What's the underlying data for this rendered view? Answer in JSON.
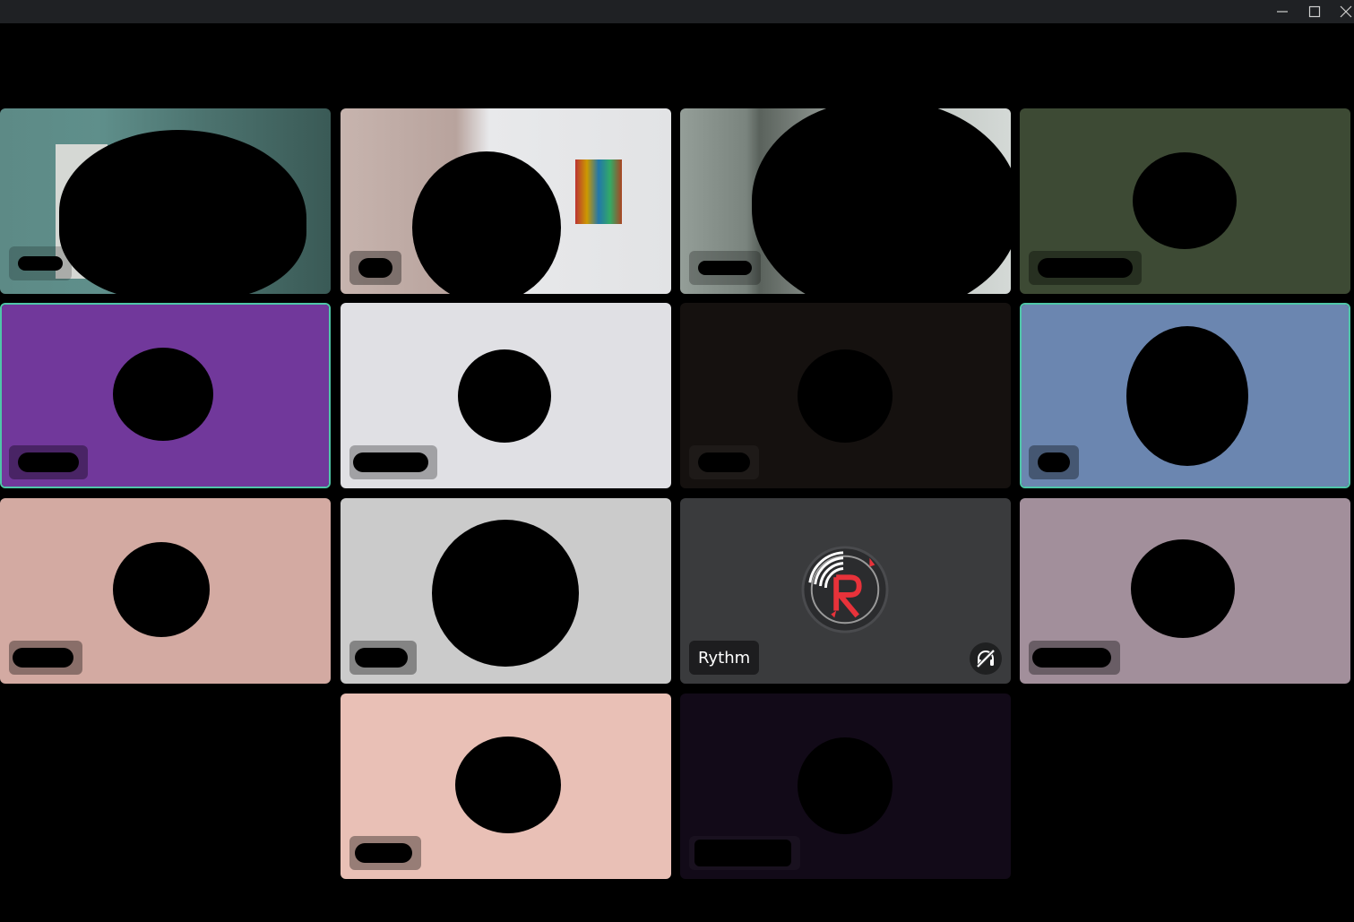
{
  "window": {
    "controls": {
      "minimize_icon": "minimize-icon",
      "maximize_icon": "maximize-icon",
      "close_icon": "close-icon"
    }
  },
  "participants": [
    {
      "id": "p1",
      "name": "",
      "speaking": false,
      "background": "#4a6e6c",
      "kind": "video"
    },
    {
      "id": "p2",
      "name": "",
      "speaking": false,
      "background": "#b9a9a4",
      "kind": "video"
    },
    {
      "id": "p3",
      "name": "",
      "speaking": false,
      "background": "#7e8580",
      "kind": "video"
    },
    {
      "id": "p4",
      "name": "",
      "speaking": false,
      "background": "#3d4a34",
      "kind": "avatar"
    },
    {
      "id": "p5",
      "name": "",
      "speaking": true,
      "background": "#71389b",
      "kind": "avatar"
    },
    {
      "id": "p6",
      "name": "",
      "speaking": false,
      "background": "#e0e0e4",
      "kind": "avatar"
    },
    {
      "id": "p7",
      "name": "",
      "speaking": false,
      "background": "#15110f",
      "kind": "avatar"
    },
    {
      "id": "p8",
      "name": "",
      "speaking": true,
      "background": "#6b86b0",
      "kind": "avatar"
    },
    {
      "id": "p9",
      "name": "",
      "speaking": false,
      "background": "#d3aaa2",
      "kind": "avatar"
    },
    {
      "id": "p10",
      "name": "",
      "speaking": false,
      "background": "#cbcbcb",
      "kind": "avatar"
    },
    {
      "id": "p11",
      "name": "Rythm",
      "speaking": false,
      "background": "#3a3b3d",
      "kind": "bot",
      "status_icon": "deafened-headphones-icon"
    },
    {
      "id": "p12",
      "name": "",
      "speaking": false,
      "background": "#a28f9b",
      "kind": "avatar"
    },
    {
      "id": "p13",
      "name": "",
      "speaking": false,
      "background": "#e9c0b6",
      "kind": "avatar"
    },
    {
      "id": "p14",
      "name": "",
      "speaking": false,
      "background": "#120a18",
      "kind": "avatar"
    }
  ],
  "colors": {
    "speaking_border": "#4fc6a8",
    "bot_logo_red": "#e8323a"
  }
}
